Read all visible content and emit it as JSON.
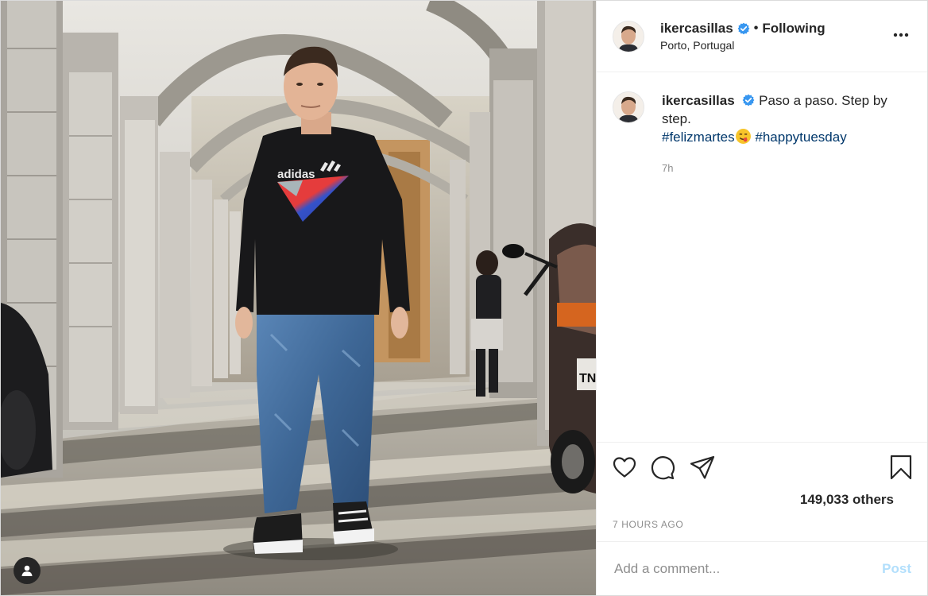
{
  "post": {
    "author": {
      "username": "ikercasillas",
      "verified": true,
      "follow_status": "Following",
      "location": "Porto, Portugal",
      "avatar_icon": "profile-photo"
    },
    "caption": {
      "username": "ikercasillas",
      "text": "Paso a paso. Step by step.",
      "hashtags": [
        "#felizmartes",
        "#happytuesday"
      ],
      "emoji": "face-savoring-food",
      "time": "7h"
    },
    "actions": {
      "like_icon": "heart-icon",
      "comment_icon": "comment-icon",
      "share_icon": "paper-plane-icon",
      "save_icon": "bookmark-icon"
    },
    "likes_text": "149,033 others",
    "timestamp": "7 HOURS AGO",
    "comment_input": {
      "placeholder": "Add a comment...",
      "value": "",
      "post_label": "Post"
    },
    "photo": {
      "shirt_text": "adidas",
      "plate_text": "TN",
      "tag_icon": "user-tag-icon"
    },
    "colors": {
      "verified": "#3897f0",
      "hashtag": "#00376b",
      "post_disabled": "#b2dffc",
      "secondary_text": "#8e8e8e"
    }
  }
}
